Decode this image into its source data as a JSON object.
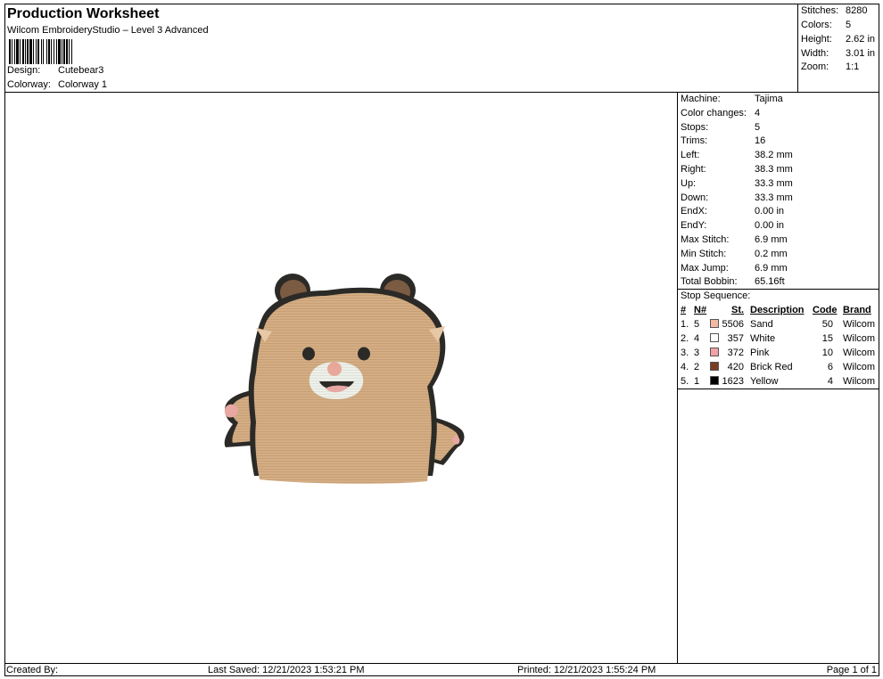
{
  "header": {
    "title": "Production Worksheet",
    "subtitle": "Wilcom EmbroideryStudio – Level 3 Advanced",
    "design_label": "Design:",
    "design_value": "Cutebear3",
    "colorway_label": "Colorway:",
    "colorway_value": "Colorway 1"
  },
  "summary": [
    {
      "label": "Stitches:",
      "value": "8280"
    },
    {
      "label": "Colors:",
      "value": "5"
    },
    {
      "label": "Height:",
      "value": "2.62 in"
    },
    {
      "label": "Width:",
      "value": "3.01 in"
    },
    {
      "label": "Zoom:",
      "value": "1:1"
    }
  ],
  "machine_info": [
    {
      "label": "Machine:",
      "value": "Tajima"
    },
    {
      "label": "Color changes:",
      "value": "4"
    },
    {
      "label": "Stops:",
      "value": "5"
    },
    {
      "label": "Trims:",
      "value": "16"
    },
    {
      "label": "Left:",
      "value": "38.2 mm"
    },
    {
      "label": "Right:",
      "value": "38.3 mm"
    },
    {
      "label": "Up:",
      "value": "33.3 mm"
    },
    {
      "label": "Down:",
      "value": "33.3 mm"
    },
    {
      "label": "EndX:",
      "value": "0.00 in"
    },
    {
      "label": "EndY:",
      "value": "0.00 in"
    },
    {
      "label": "Max Stitch:",
      "value": "6.9 mm"
    },
    {
      "label": "Min Stitch:",
      "value": "0.2 mm"
    },
    {
      "label": "Max Jump:",
      "value": "6.9 mm"
    },
    {
      "label": "Total Bobbin:",
      "value": "65.16ft"
    }
  ],
  "stop_sequence": {
    "title": "Stop Sequence:",
    "headers": {
      "num": "#",
      "n": "N#",
      "st": "St.",
      "desc": "Description",
      "code": "Code",
      "brand": "Brand"
    },
    "rows": [
      {
        "num": "1.",
        "n": "5",
        "st": "5506",
        "desc": "Sand",
        "code": "50",
        "brand": "Wilcom",
        "color": "#f3b8a2"
      },
      {
        "num": "2.",
        "n": "4",
        "st": "357",
        "desc": "White",
        "code": "15",
        "brand": "Wilcom",
        "color": "#ffffff"
      },
      {
        "num": "3.",
        "n": "3",
        "st": "372",
        "desc": "Pink",
        "code": "10",
        "brand": "Wilcom",
        "color": "#f2a2a4"
      },
      {
        "num": "4.",
        "n": "2",
        "st": "420",
        "desc": "Brick Red",
        "code": "6",
        "brand": "Wilcom",
        "color": "#7a3d22"
      },
      {
        "num": "5.",
        "n": "1",
        "st": "1623",
        "desc": "Yellow",
        "code": "4",
        "brand": "Wilcom",
        "color": "#000000"
      }
    ]
  },
  "footer": {
    "created_by": "Created By:",
    "last_saved": "Last Saved: 12/21/2023 1:53:21 PM",
    "printed": "Printed: 12/21/2023 1:55:24 PM",
    "page": "Page 1 of 1"
  },
  "colors": {
    "fur": "#d4ad84",
    "outline": "#2b2a27",
    "ear_inner": "#7c5b43",
    "muzzle": "#eef0ea",
    "nose": "#e8a899",
    "paw": "#e8a7a2"
  }
}
